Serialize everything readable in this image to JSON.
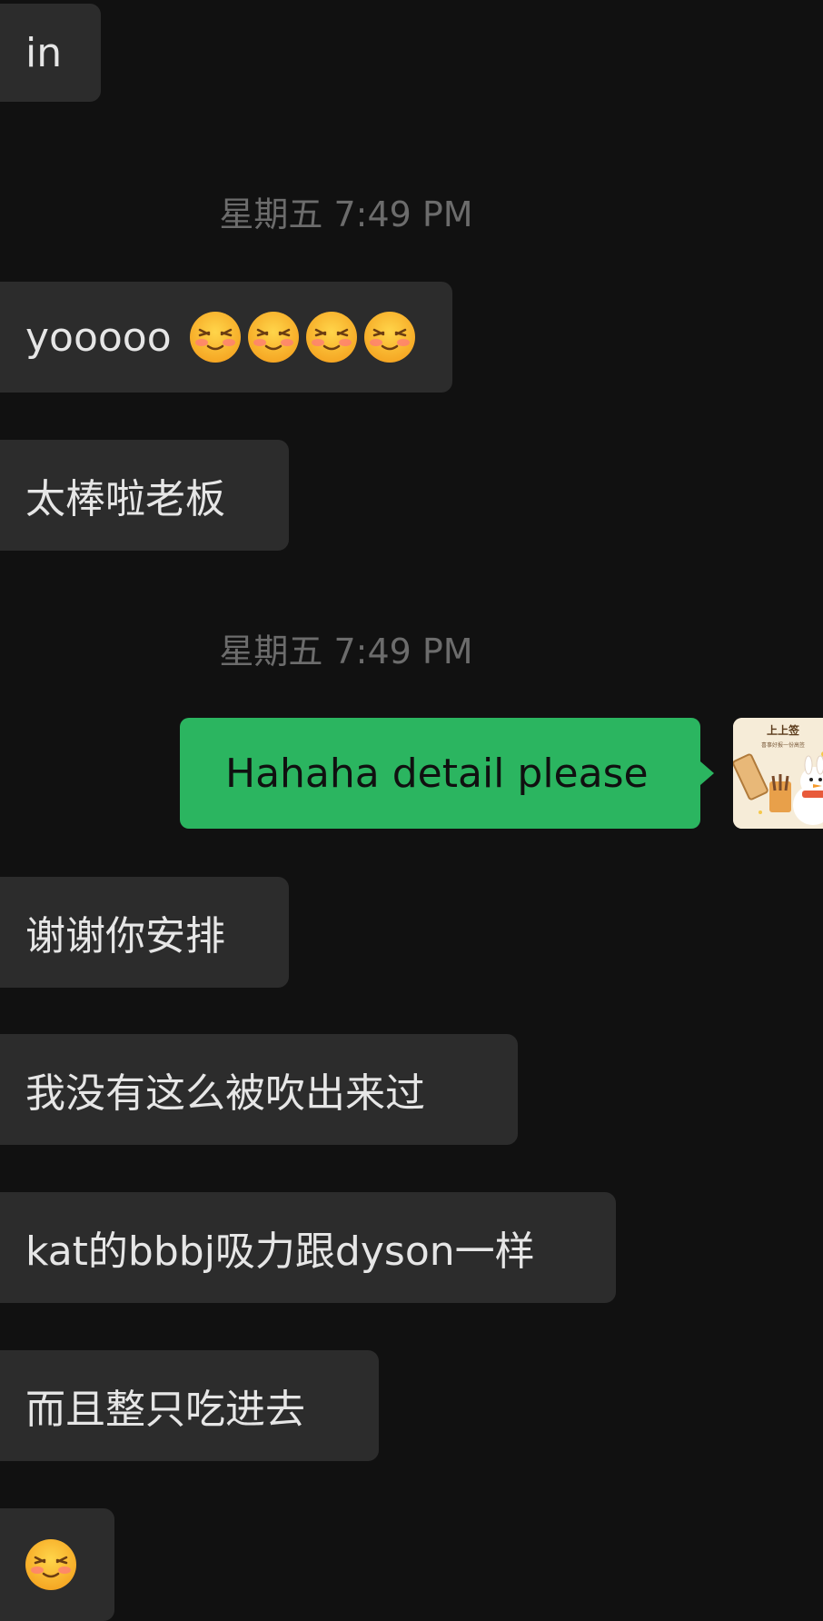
{
  "messages": {
    "m1": {
      "text": "in"
    },
    "time1": {
      "text": "星期五 7:49 PM"
    },
    "m2": {
      "text": "yooooo",
      "emojis": [
        "blushing-smile-emoji",
        "blushing-smile-emoji",
        "blushing-smile-emoji",
        "blushing-smile-emoji"
      ]
    },
    "m3": {
      "text": "太棒啦老板"
    },
    "time2": {
      "text": "星期五 7:49 PM"
    },
    "m4": {
      "text": "Hahaha detail please"
    },
    "m5": {
      "text": "谢谢你安排"
    },
    "m6": {
      "text": "我没有这么被吹出来过"
    },
    "m7": {
      "text": "kat的bbbj吸力跟dyson一样"
    },
    "m8": {
      "text": "而且整只吃进去"
    },
    "m9": {
      "emojis": [
        "blushing-smile-emoji"
      ]
    }
  },
  "avatar": {
    "title": "上上签",
    "caption": "喜事好报一份高签",
    "icon": "snowman-sticker-avatar"
  },
  "colors": {
    "background": "#111111",
    "received_bubble": "#2c2c2c",
    "sent_bubble": "#2bb560",
    "timestamp": "#6c6c6c"
  }
}
